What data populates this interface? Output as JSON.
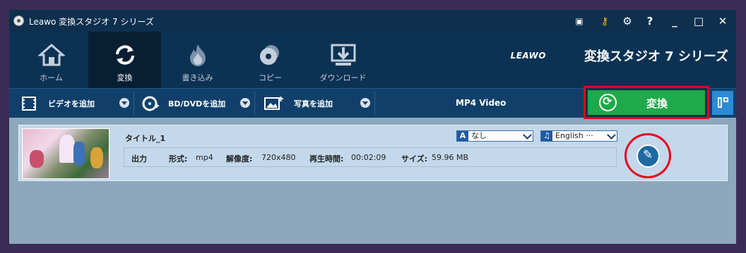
{
  "window": {
    "title": "Leawo 変換スタジオ 7 シリーズ"
  },
  "nav": [
    {
      "label": "ホーム",
      "icon": "home-icon"
    },
    {
      "label": "変換",
      "icon": "convert-icon",
      "active": true
    },
    {
      "label": "書き込み",
      "icon": "burn-icon"
    },
    {
      "label": "コピー",
      "icon": "copy-disc-icon"
    },
    {
      "label": "ダウンロード",
      "icon": "download-icon"
    }
  ],
  "brand": {
    "logo": "LEAWO",
    "product": "変換スタジオ 7 シリーズ"
  },
  "toolbar": {
    "add_video": "ビデオを追加",
    "add_bd": "BD/DVDを追加",
    "add_photo": "写真を追加",
    "profile": "MP4 Video",
    "convert": "変換"
  },
  "item": {
    "title": "タイトル_1",
    "subtitle": "なし",
    "audio": "English ···",
    "output_label": "出力",
    "format_label": "形式:",
    "format": "mp4",
    "resolution_label": "解像度:",
    "resolution": "720x480",
    "duration_label": "再生時間:",
    "duration": "00:02:09",
    "size_label": "サイズ:",
    "size": "59.96 MB"
  },
  "colors": {
    "convert_green": "#1fa94a",
    "highlight_red": "#e8001b",
    "nav_bg": "#0b3253"
  }
}
